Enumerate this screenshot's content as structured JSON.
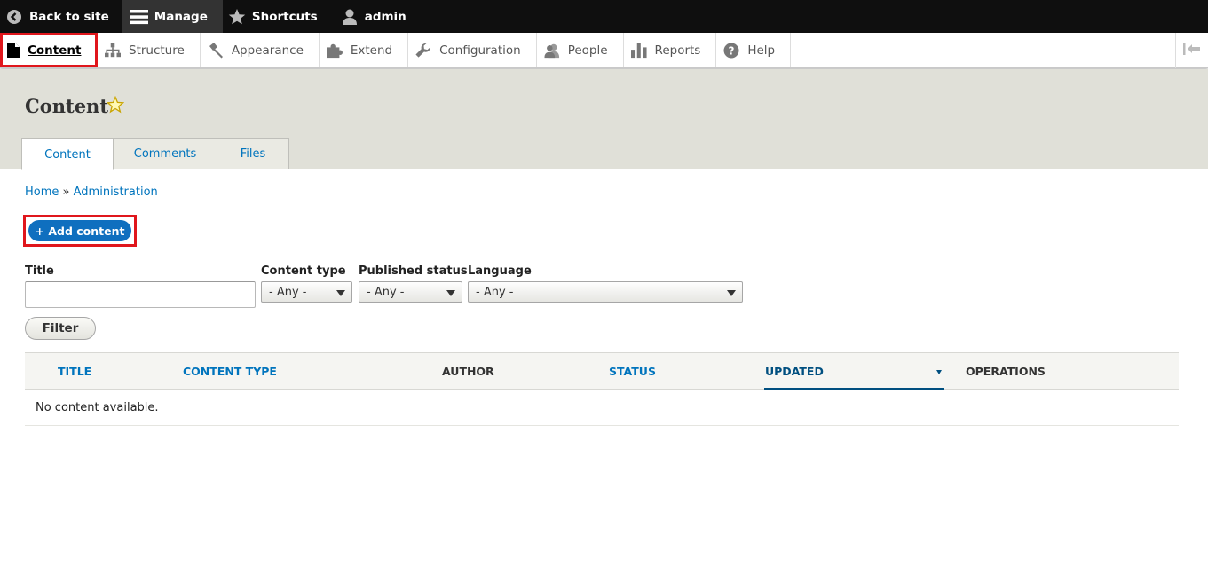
{
  "toolbar": {
    "back": "Back to site",
    "manage": "Manage",
    "shortcuts": "Shortcuts",
    "user": "admin"
  },
  "tray": {
    "items": [
      "Content",
      "Structure",
      "Appearance",
      "Extend",
      "Configuration",
      "People",
      "Reports",
      "Help"
    ]
  },
  "page": {
    "title": "Content",
    "tabs": [
      "Content",
      "Comments",
      "Files"
    ]
  },
  "breadcrumb": {
    "home": "Home",
    "sep": "»",
    "admin": "Administration"
  },
  "actions": {
    "add": "+ Add content"
  },
  "filters": {
    "title_label": "Title",
    "title_value": "",
    "type_label": "Content type",
    "type_value": "- Any -",
    "status_label": "Published status",
    "status_value": "- Any -",
    "language_label": "Language",
    "language_value": "- Any -",
    "filter_button": "Filter"
  },
  "table": {
    "columns": [
      "Title",
      "Content type",
      "Author",
      "Status",
      "Updated",
      "Operations"
    ],
    "empty": "No content available."
  },
  "colors": {
    "accent": "#0074bd",
    "highlight": "#e0161c",
    "button": "#0f6fbf"
  }
}
